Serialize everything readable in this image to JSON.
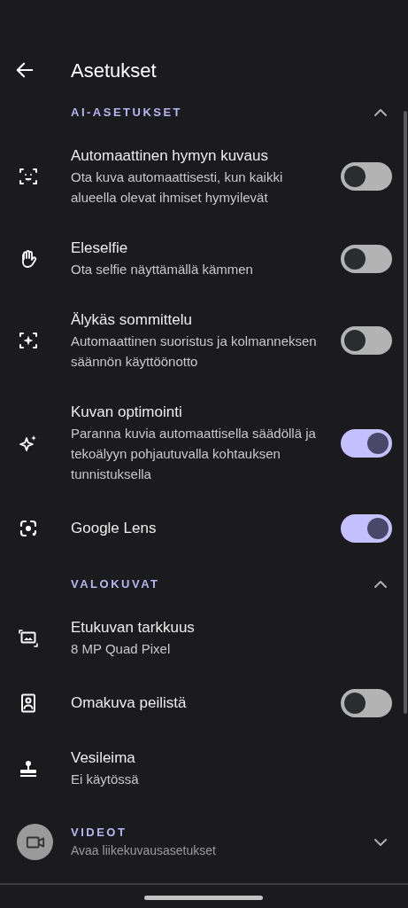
{
  "header": {
    "title": "Asetukset"
  },
  "sections": [
    {
      "title": "AI-ASETUKSET",
      "expanded": true,
      "items": [
        {
          "kind": "toggle",
          "title": "Automaattinen hymyn kuvaus",
          "subtitle": "Ota kuva automaattisesti, kun kaikki alueella olevat ihmiset hymyilevät",
          "on": false
        },
        {
          "kind": "toggle",
          "title": "Eleselfie",
          "subtitle": "Ota selfie näyttämällä kämmen",
          "on": false
        },
        {
          "kind": "toggle",
          "title": "Älykäs sommittelu",
          "subtitle": "Automaattinen suoristus ja kolmanneksen säännön käyttöönotto",
          "on": false
        },
        {
          "kind": "toggle",
          "title": "Kuvan optimointi",
          "subtitle": "Paranna kuvia automaattisella säädöllä ja tekoälyyn pohjautuvalla kohtauksen tunnistuksella",
          "on": true
        },
        {
          "kind": "toggle",
          "title": "Google Lens",
          "on": true
        }
      ]
    },
    {
      "title": "VALOKUVAT",
      "expanded": true,
      "items": [
        {
          "kind": "value",
          "title": "Etukuvan tarkkuus",
          "subtitle": "8 MP Quad Pixel"
        },
        {
          "kind": "toggle",
          "title": "Omakuva peilistä",
          "on": false
        },
        {
          "kind": "value",
          "title": "Vesileima",
          "subtitle": "Ei käytössä"
        }
      ]
    },
    {
      "title": "VIDEOT",
      "subtitle": "Avaa liikekuvausasetukset",
      "expanded": false
    }
  ]
}
